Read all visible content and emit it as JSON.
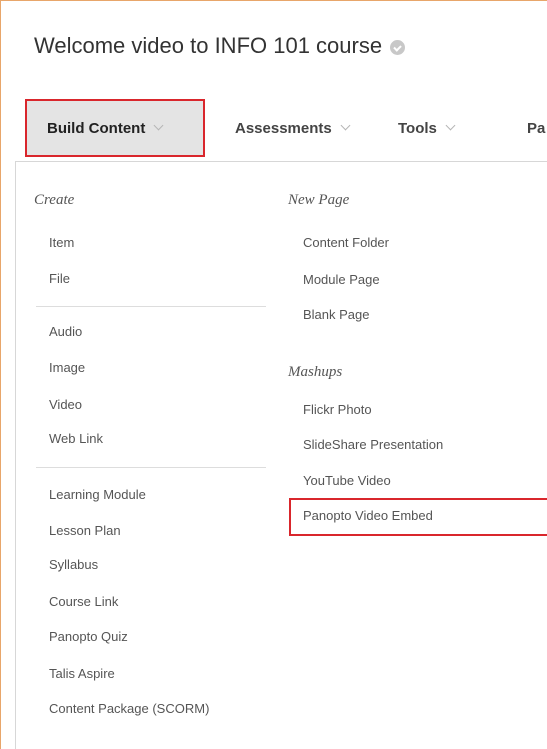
{
  "page": {
    "title": "Welcome video to INFO 101 course"
  },
  "toolbar": {
    "items": [
      {
        "label": "Build Content"
      },
      {
        "label": "Assessments"
      },
      {
        "label": "Tools"
      },
      {
        "label": "Pa"
      }
    ]
  },
  "menu": {
    "create": {
      "label": "Create",
      "items": [
        "Item",
        "File",
        "Audio",
        "Image",
        "Video",
        "Web Link",
        "Learning Module",
        "Lesson Plan",
        "Syllabus",
        "Course Link",
        "Panopto Quiz",
        "Talis Aspire",
        "Content Package (SCORM)"
      ]
    },
    "new_page": {
      "label": "New Page",
      "items": [
        "Content Folder",
        "Module Page",
        "Blank Page"
      ]
    },
    "mashups": {
      "label": "Mashups",
      "items": [
        "Flickr Photo",
        "SlideShare Presentation",
        "YouTube Video",
        "Panopto Video Embed"
      ]
    }
  },
  "colors": {
    "highlight": "#d9262c",
    "frame_border": "#e8a66a",
    "active_tab_bg": "#e4e4e4"
  }
}
